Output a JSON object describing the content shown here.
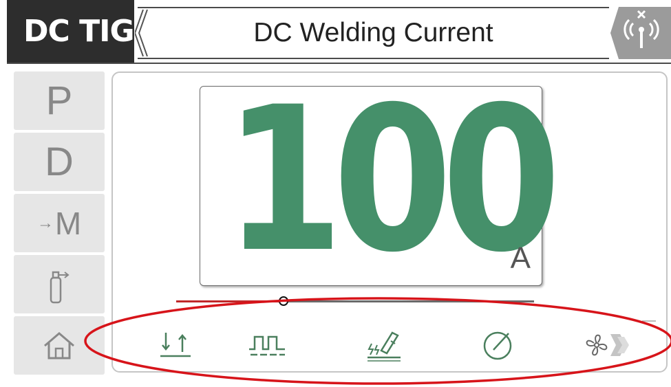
{
  "header": {
    "mode": "DC TIG",
    "title": "DC Welding Current"
  },
  "sidebar": {
    "items": [
      {
        "label": "P"
      },
      {
        "label": "D"
      },
      {
        "label": "M"
      },
      {
        "label": "gas-bottle-icon"
      },
      {
        "label": "home-icon"
      }
    ]
  },
  "display": {
    "value": "100",
    "unit": "A",
    "slider_fraction": 0.3
  },
  "icon_bar": {
    "items": [
      "trigger-mode-icon",
      "pulse-icon",
      "torch-icon",
      "gauge-icon",
      "fan-icon"
    ]
  },
  "colors": {
    "value_green": "#45906a",
    "annotation_red": "#d7141a",
    "header_dark": "#2d2d2d"
  }
}
